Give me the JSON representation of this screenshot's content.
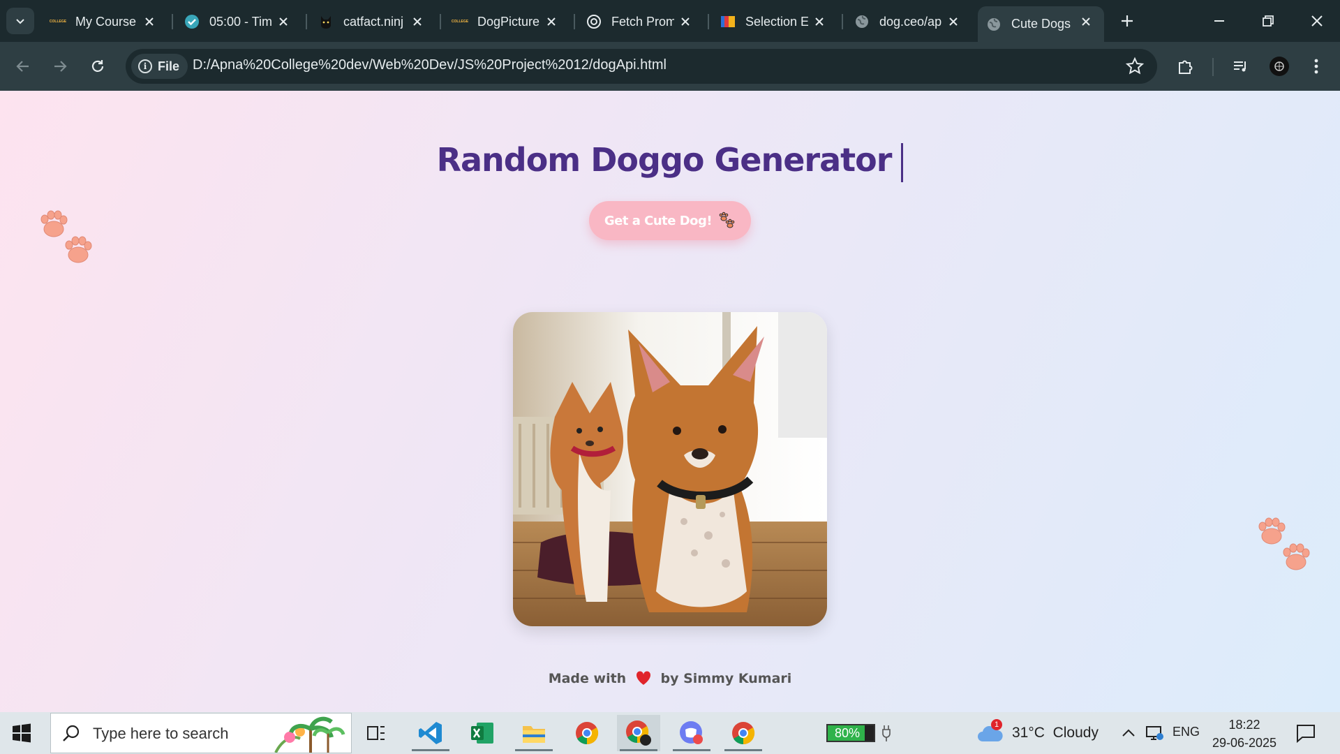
{
  "browser": {
    "tabs": [
      {
        "title": "My Course",
        "icon": "college-favicon-icon"
      },
      {
        "title": "05:00 - Tim",
        "icon": "check-circle-icon"
      },
      {
        "title": "catfact.ninj",
        "icon": "cat-icon"
      },
      {
        "title": "DogPicture",
        "icon": "college-favicon-icon"
      },
      {
        "title": "Fetch Prom",
        "icon": "openai-icon"
      },
      {
        "title": "Selection E",
        "icon": "zb-icon"
      },
      {
        "title": "dog.ceo/ap",
        "icon": "globe-icon"
      },
      {
        "title": "Cute Dogs",
        "icon": "globe-icon",
        "active": true
      }
    ],
    "favicon_badge": "COLLEGE",
    "address_chip": "File",
    "url": "D:/Apna%20College%20dev/Web%20Dev/JS%20Project%2012/dogApi.html"
  },
  "page": {
    "title": "Random Doggo Generator",
    "button_label": "Get a Cute Dog!",
    "footer_before": "Made with",
    "footer_after": "by Simmy Kumari",
    "image_subject": "two basenji dogs sitting on a wooden bench"
  },
  "taskbar": {
    "search_placeholder": "Type here to search",
    "battery_percent": "80%",
    "battery_level": 0.8,
    "weather_badge": "1",
    "weather": "31°C  Cloudy",
    "language": "ENG",
    "time": "18:22",
    "date": "29-06-2025"
  },
  "colors": {
    "title": "#4b2f86",
    "button": "#f9b7c4",
    "paw": "#f6a28c",
    "heart": "#e0242b"
  }
}
